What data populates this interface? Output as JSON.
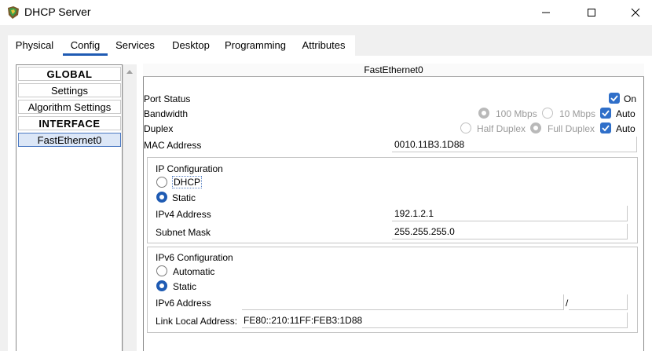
{
  "window": {
    "title": "DHCP Server"
  },
  "tabs": [
    {
      "label": "Physical"
    },
    {
      "label": "Config"
    },
    {
      "label": "Services"
    },
    {
      "label": "Desktop"
    },
    {
      "label": "Programming"
    },
    {
      "label": "Attributes"
    }
  ],
  "sidebar": {
    "items": [
      {
        "label": "GLOBAL"
      },
      {
        "label": "Settings"
      },
      {
        "label": "Algorithm Settings"
      },
      {
        "label": "INTERFACE"
      },
      {
        "label": "FastEthernet0"
      }
    ]
  },
  "panel": {
    "header": "FastEthernet0",
    "port_status": {
      "label": "Port Status",
      "on_label": "On",
      "on": true
    },
    "bandwidth": {
      "label": "Bandwidth",
      "opt_100": "100 Mbps",
      "opt_10": "10 Mbps",
      "auto_label": "Auto",
      "auto": true
    },
    "duplex": {
      "label": "Duplex",
      "opt_half": "Half Duplex",
      "opt_full": "Full Duplex",
      "auto_label": "Auto",
      "auto": true
    },
    "mac": {
      "label": "MAC Address",
      "value": "0010.11B3.1D88"
    },
    "ipv4": {
      "group_label": "IP Configuration",
      "dhcp_label": "DHCP",
      "static_label": "Static",
      "mode": "Static",
      "address_label": "IPv4 Address",
      "address": "192.1.2.1",
      "mask_label": "Subnet Mask",
      "mask": "255.255.255.0"
    },
    "ipv6": {
      "group_label": "IPv6 Configuration",
      "auto_label": "Automatic",
      "static_label": "Static",
      "mode": "Static",
      "address_label": "IPv6 Address",
      "address": "",
      "prefix_separator": "/",
      "prefix": "",
      "link_local_label": "Link Local Address:",
      "link_local": "FE80::210:11FF:FEB3:1D88"
    }
  },
  "colors": {
    "accent": "#1f5bb3",
    "checkbox": "#2f6fc9",
    "selected_bg": "#dce7f7",
    "disabled_text": "#9a9a9a"
  }
}
